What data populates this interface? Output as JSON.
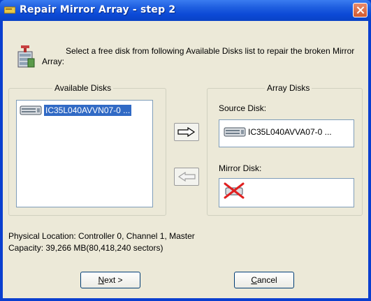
{
  "window": {
    "title": "Repair Mirror Array - step 2"
  },
  "instruction": "Select a free disk from following Available Disks list to repair the broken Mirror Array:",
  "available_disks": {
    "label": "Available Disks",
    "items": [
      {
        "name": "IC35L040AVVN07-0 ..."
      }
    ]
  },
  "array_disks": {
    "label": "Array Disks",
    "source_label": "Source Disk:",
    "source_value": "IC35L040AVVA07-0 ...",
    "mirror_label": "Mirror Disk:"
  },
  "info": {
    "location": "Physical Location: Controller 0, Channel 1, Master",
    "capacity": "Capacity: 39,266 MB(80,418,240 sectors)"
  },
  "buttons": {
    "next_mnemonic": "N",
    "next_rest": "ext >",
    "cancel_mnemonic": "C",
    "cancel_rest": "ancel"
  }
}
